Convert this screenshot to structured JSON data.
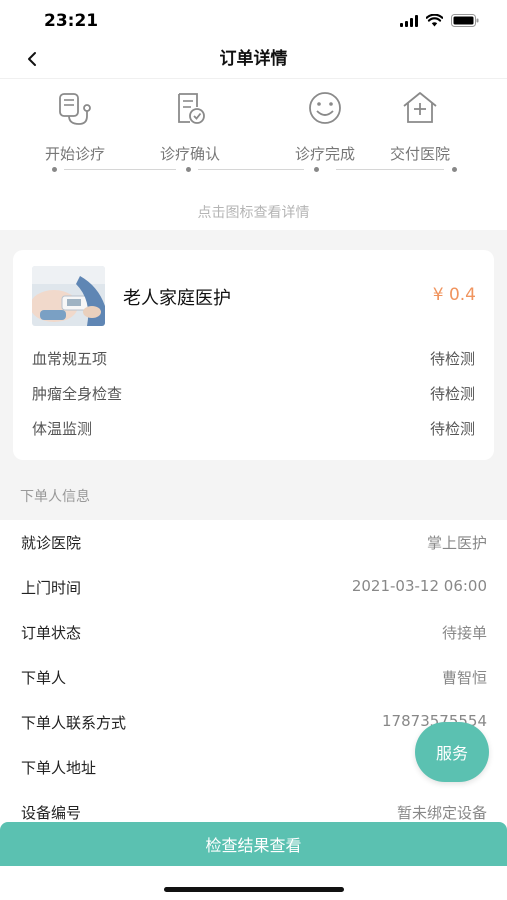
{
  "status_bar": {
    "time": "23:21",
    "icons": [
      "signal-icon",
      "wifi-icon",
      "battery-icon"
    ]
  },
  "nav": {
    "title": "订单详情",
    "back_icon": "chevron-left-icon"
  },
  "progress": {
    "steps": [
      {
        "label": "开始诊疗",
        "icon": "stethoscope-icon"
      },
      {
        "label": "诊疗确认",
        "icon": "document-check-icon"
      },
      {
        "label": "诊疗完成",
        "icon": "smile-icon"
      },
      {
        "label": "交付医院",
        "icon": "hospital-icon"
      }
    ],
    "hint": "点击图标查看详情"
  },
  "service": {
    "name": "老人家庭医护",
    "price": "¥ 0.4",
    "items": [
      {
        "name": "血常规五项",
        "status": "待检测"
      },
      {
        "name": "肿瘤全身检查",
        "status": "待检测"
      },
      {
        "name": "体温监测",
        "status": "待检测"
      }
    ]
  },
  "orderer_section": {
    "title": "下单人信息",
    "rows": [
      {
        "label": "就诊医院",
        "value": "掌上医护"
      },
      {
        "label": "上门时间",
        "value": "2021-03-12 06:00"
      },
      {
        "label": "订单状态",
        "value": "待接单"
      },
      {
        "label": "下单人",
        "value": "曹智恒"
      },
      {
        "label": "下单人联系方式",
        "value": "17873575554"
      },
      {
        "label": "下单人地址",
        "value": ""
      },
      {
        "label": "设备编号",
        "value": "暂未绑定设备"
      }
    ]
  },
  "fab_label": "服务",
  "bottom_button": "检查结果查看",
  "colors": {
    "accent": "#5bc1b1",
    "price": "#f0945e",
    "muted": "#999999"
  }
}
